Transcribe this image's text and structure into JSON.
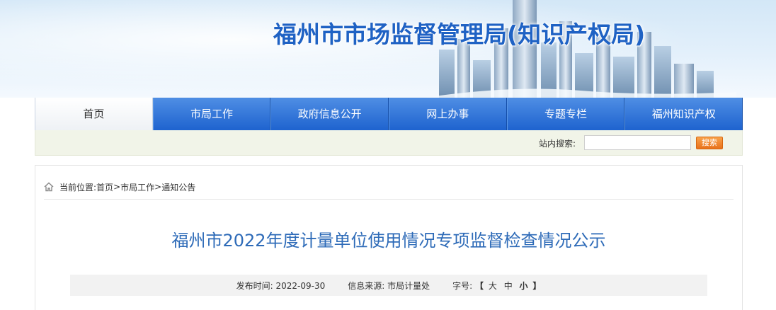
{
  "header": {
    "site_title": "福州市市场监督管理局(知识产权局)"
  },
  "nav": {
    "items": [
      {
        "label": "首页",
        "active": true
      },
      {
        "label": "市局工作",
        "active": false
      },
      {
        "label": "政府信息公开",
        "active": false
      },
      {
        "label": "网上办事",
        "active": false
      },
      {
        "label": "专题专栏",
        "active": false
      },
      {
        "label": "福州知识产权",
        "active": false
      }
    ]
  },
  "search": {
    "label": "站内搜索:",
    "value": "",
    "button_label": "搜索"
  },
  "breadcrumb": {
    "prefix": "当前位置:",
    "items": [
      "首页",
      "市局工作",
      "通知公告"
    ],
    "separator": ">"
  },
  "article": {
    "title": "福州市2022年度计量单位使用情况专项监督检查情况公示",
    "publish_label": "发布时间:",
    "publish_date": "2022-09-30",
    "source_label": "信息来源:",
    "source_value": "市局计量处",
    "font_size_label": "字号:",
    "font_size_open": "【",
    "font_size_large": "大",
    "font_size_medium": "中",
    "font_size_small": "小",
    "font_size_close": "】"
  },
  "colors": {
    "nav_blue": "#1e63cf",
    "title_blue": "#1f62c4",
    "article_title_blue": "#2e6bb8",
    "search_button_orange": "#e8711b",
    "searchbar_bg": "#f1f4e8"
  }
}
